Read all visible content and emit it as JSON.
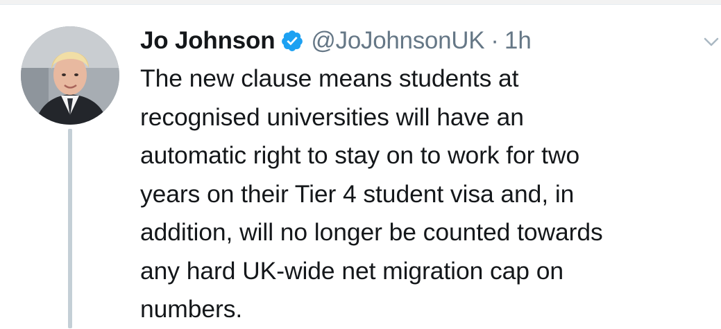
{
  "tweet": {
    "author": {
      "display_name": "Jo Johnson",
      "handle": "@JoJohnsonUK",
      "verified": true,
      "avatar": "profile-photo"
    },
    "separator": "·",
    "timestamp": "1h",
    "text_lines": [
      "The new clause means students at",
      "recognised universities will have an",
      "automatic right to stay on to work for two",
      "years on their Tier 4 student visa and, in",
      "addition, will no longer be counted towards",
      "any hard UK-wide net migration cap on",
      "numbers."
    ],
    "menu_icon": "chevron-down-icon"
  },
  "colors": {
    "text_primary": "#14171a",
    "text_secondary": "#657786",
    "verified_blue": "#1da1f2",
    "thread_line": "#c4cfd6"
  }
}
